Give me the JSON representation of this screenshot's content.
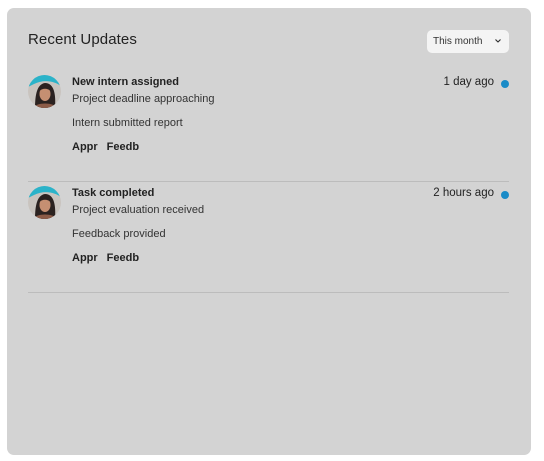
{
  "panel": {
    "title": "Recent Updates",
    "filter": {
      "selected": "This month",
      "icon": "chevron-down-icon"
    }
  },
  "updates": [
    {
      "title": "New intern assigned",
      "line1": "Project deadline approaching",
      "line2": "Intern submitted report",
      "time": "1 day ago",
      "actions": [
        "Appr",
        "Feedb"
      ],
      "unread": true,
      "avatar": "user-avatar"
    },
    {
      "title": "Task completed",
      "line1": "Project evaluation received",
      "line2": "Feedback provided",
      "time": "2 hours ago",
      "actions": [
        "Appr",
        "Feedb"
      ],
      "unread": true,
      "avatar": "user-avatar"
    }
  ],
  "colors": {
    "card_bg": "#d3d3d3",
    "unread_dot": "#1a8bc7",
    "avatar_accent": "#2bb3c9"
  }
}
